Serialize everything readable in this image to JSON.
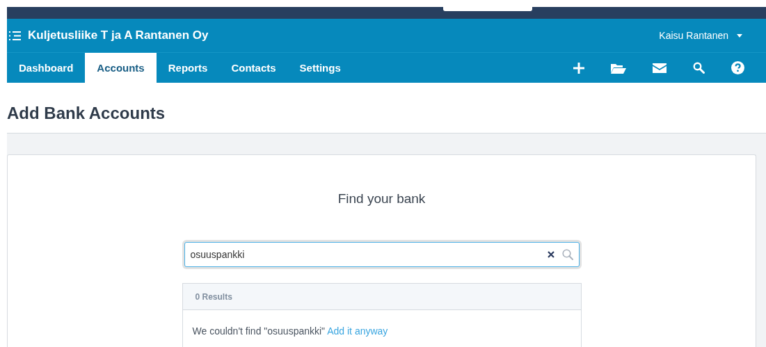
{
  "header": {
    "org_name": "Kuljetusliike T ja A Rantanen Oy",
    "user_name": "Kaisu Rantanen"
  },
  "tabs": [
    {
      "label": "Dashboard",
      "selected": false
    },
    {
      "label": "Accounts",
      "selected": true
    },
    {
      "label": "Reports",
      "selected": false
    },
    {
      "label": "Contacts",
      "selected": false
    },
    {
      "label": "Settings",
      "selected": false
    }
  ],
  "page_title": "Add Bank Accounts",
  "finder": {
    "heading": "Find your bank",
    "search_value": "osuuspankki",
    "results_count": "0 Results",
    "message": "We couldn't find \"osuuspankki\"",
    "link": "Add it anyway"
  }
}
